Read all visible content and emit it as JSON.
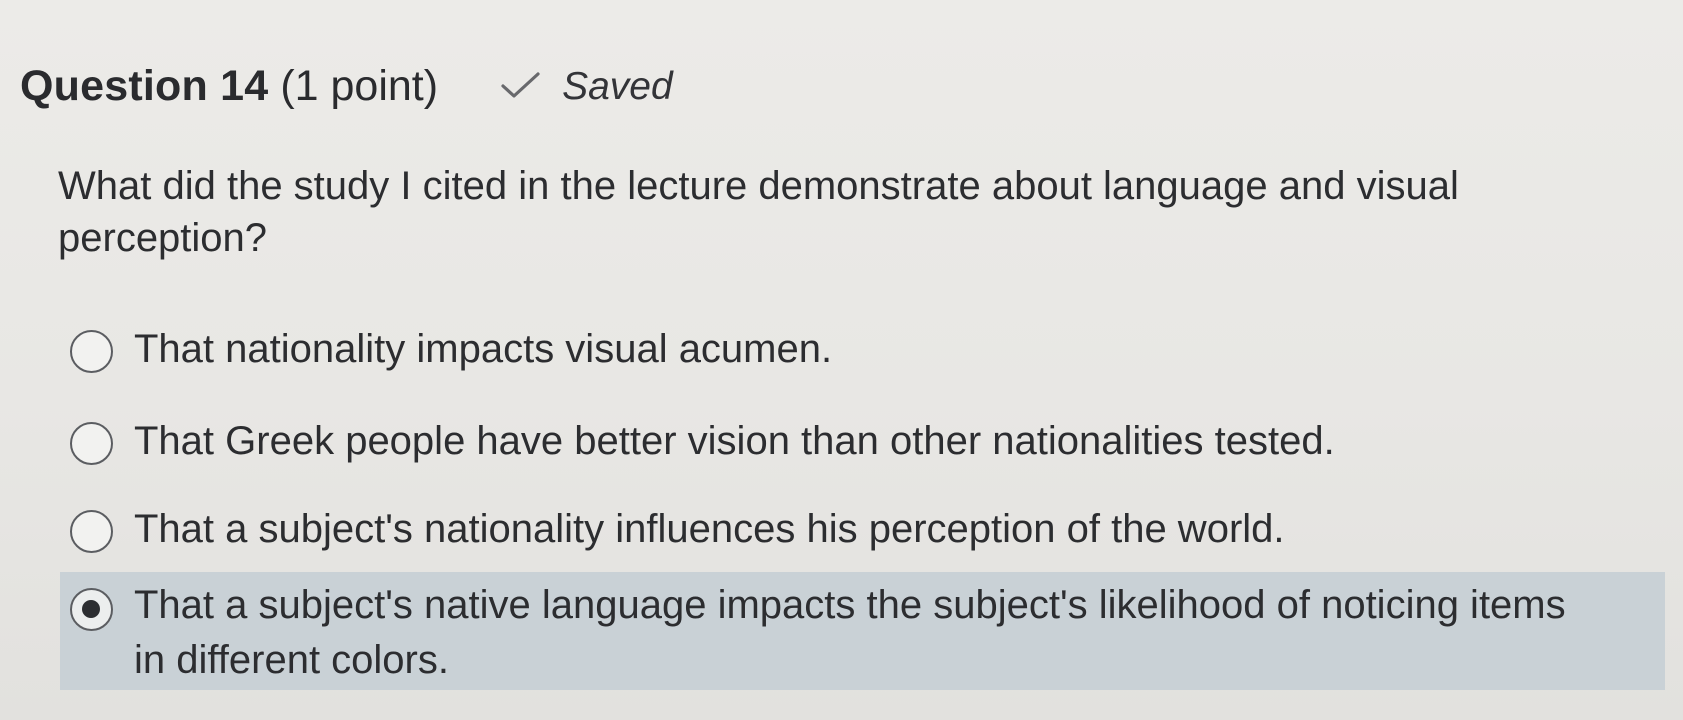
{
  "question": {
    "title": "Question 14",
    "points": "(1 point)",
    "saved_label": "Saved",
    "saved_icon": "check-icon",
    "prompt": "What did the study I cited in the lecture demonstrate about language and visual perception?"
  },
  "options": [
    {
      "label": "That nationality impacts visual acumen.",
      "selected": false
    },
    {
      "label": "That Greek people have better vision than other nationalities tested.",
      "selected": false
    },
    {
      "label": "That a subject's nationality influences his perception of the world.",
      "selected": false
    },
    {
      "label": "That a subject's native language impacts the subject's likelihood of noticing items in different colors.",
      "selected": true
    }
  ],
  "colors": {
    "selected_highlight": "#c9d1d6",
    "text": "#2c2d30",
    "background": "#ebeae7"
  }
}
